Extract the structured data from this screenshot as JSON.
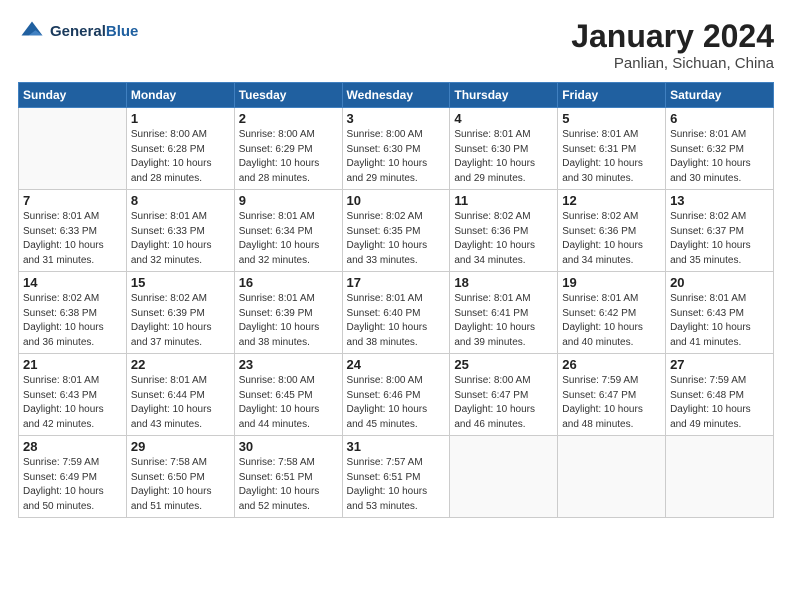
{
  "header": {
    "logo_line1": "General",
    "logo_line2": "Blue",
    "month": "January 2024",
    "location": "Panlian, Sichuan, China"
  },
  "weekdays": [
    "Sunday",
    "Monday",
    "Tuesday",
    "Wednesday",
    "Thursday",
    "Friday",
    "Saturday"
  ],
  "weeks": [
    [
      {
        "day": "",
        "info": ""
      },
      {
        "day": "1",
        "info": "Sunrise: 8:00 AM\nSunset: 6:28 PM\nDaylight: 10 hours\nand 28 minutes."
      },
      {
        "day": "2",
        "info": "Sunrise: 8:00 AM\nSunset: 6:29 PM\nDaylight: 10 hours\nand 28 minutes."
      },
      {
        "day": "3",
        "info": "Sunrise: 8:00 AM\nSunset: 6:30 PM\nDaylight: 10 hours\nand 29 minutes."
      },
      {
        "day": "4",
        "info": "Sunrise: 8:01 AM\nSunset: 6:30 PM\nDaylight: 10 hours\nand 29 minutes."
      },
      {
        "day": "5",
        "info": "Sunrise: 8:01 AM\nSunset: 6:31 PM\nDaylight: 10 hours\nand 30 minutes."
      },
      {
        "day": "6",
        "info": "Sunrise: 8:01 AM\nSunset: 6:32 PM\nDaylight: 10 hours\nand 30 minutes."
      }
    ],
    [
      {
        "day": "7",
        "info": "Sunrise: 8:01 AM\nSunset: 6:33 PM\nDaylight: 10 hours\nand 31 minutes."
      },
      {
        "day": "8",
        "info": "Sunrise: 8:01 AM\nSunset: 6:33 PM\nDaylight: 10 hours\nand 32 minutes."
      },
      {
        "day": "9",
        "info": "Sunrise: 8:01 AM\nSunset: 6:34 PM\nDaylight: 10 hours\nand 32 minutes."
      },
      {
        "day": "10",
        "info": "Sunrise: 8:02 AM\nSunset: 6:35 PM\nDaylight: 10 hours\nand 33 minutes."
      },
      {
        "day": "11",
        "info": "Sunrise: 8:02 AM\nSunset: 6:36 PM\nDaylight: 10 hours\nand 34 minutes."
      },
      {
        "day": "12",
        "info": "Sunrise: 8:02 AM\nSunset: 6:36 PM\nDaylight: 10 hours\nand 34 minutes."
      },
      {
        "day": "13",
        "info": "Sunrise: 8:02 AM\nSunset: 6:37 PM\nDaylight: 10 hours\nand 35 minutes."
      }
    ],
    [
      {
        "day": "14",
        "info": "Sunrise: 8:02 AM\nSunset: 6:38 PM\nDaylight: 10 hours\nand 36 minutes."
      },
      {
        "day": "15",
        "info": "Sunrise: 8:02 AM\nSunset: 6:39 PM\nDaylight: 10 hours\nand 37 minutes."
      },
      {
        "day": "16",
        "info": "Sunrise: 8:01 AM\nSunset: 6:39 PM\nDaylight: 10 hours\nand 38 minutes."
      },
      {
        "day": "17",
        "info": "Sunrise: 8:01 AM\nSunset: 6:40 PM\nDaylight: 10 hours\nand 38 minutes."
      },
      {
        "day": "18",
        "info": "Sunrise: 8:01 AM\nSunset: 6:41 PM\nDaylight: 10 hours\nand 39 minutes."
      },
      {
        "day": "19",
        "info": "Sunrise: 8:01 AM\nSunset: 6:42 PM\nDaylight: 10 hours\nand 40 minutes."
      },
      {
        "day": "20",
        "info": "Sunrise: 8:01 AM\nSunset: 6:43 PM\nDaylight: 10 hours\nand 41 minutes."
      }
    ],
    [
      {
        "day": "21",
        "info": "Sunrise: 8:01 AM\nSunset: 6:43 PM\nDaylight: 10 hours\nand 42 minutes."
      },
      {
        "day": "22",
        "info": "Sunrise: 8:01 AM\nSunset: 6:44 PM\nDaylight: 10 hours\nand 43 minutes."
      },
      {
        "day": "23",
        "info": "Sunrise: 8:00 AM\nSunset: 6:45 PM\nDaylight: 10 hours\nand 44 minutes."
      },
      {
        "day": "24",
        "info": "Sunrise: 8:00 AM\nSunset: 6:46 PM\nDaylight: 10 hours\nand 45 minutes."
      },
      {
        "day": "25",
        "info": "Sunrise: 8:00 AM\nSunset: 6:47 PM\nDaylight: 10 hours\nand 46 minutes."
      },
      {
        "day": "26",
        "info": "Sunrise: 7:59 AM\nSunset: 6:47 PM\nDaylight: 10 hours\nand 48 minutes."
      },
      {
        "day": "27",
        "info": "Sunrise: 7:59 AM\nSunset: 6:48 PM\nDaylight: 10 hours\nand 49 minutes."
      }
    ],
    [
      {
        "day": "28",
        "info": "Sunrise: 7:59 AM\nSunset: 6:49 PM\nDaylight: 10 hours\nand 50 minutes."
      },
      {
        "day": "29",
        "info": "Sunrise: 7:58 AM\nSunset: 6:50 PM\nDaylight: 10 hours\nand 51 minutes."
      },
      {
        "day": "30",
        "info": "Sunrise: 7:58 AM\nSunset: 6:51 PM\nDaylight: 10 hours\nand 52 minutes."
      },
      {
        "day": "31",
        "info": "Sunrise: 7:57 AM\nSunset: 6:51 PM\nDaylight: 10 hours\nand 53 minutes."
      },
      {
        "day": "",
        "info": ""
      },
      {
        "day": "",
        "info": ""
      },
      {
        "day": "",
        "info": ""
      }
    ]
  ]
}
